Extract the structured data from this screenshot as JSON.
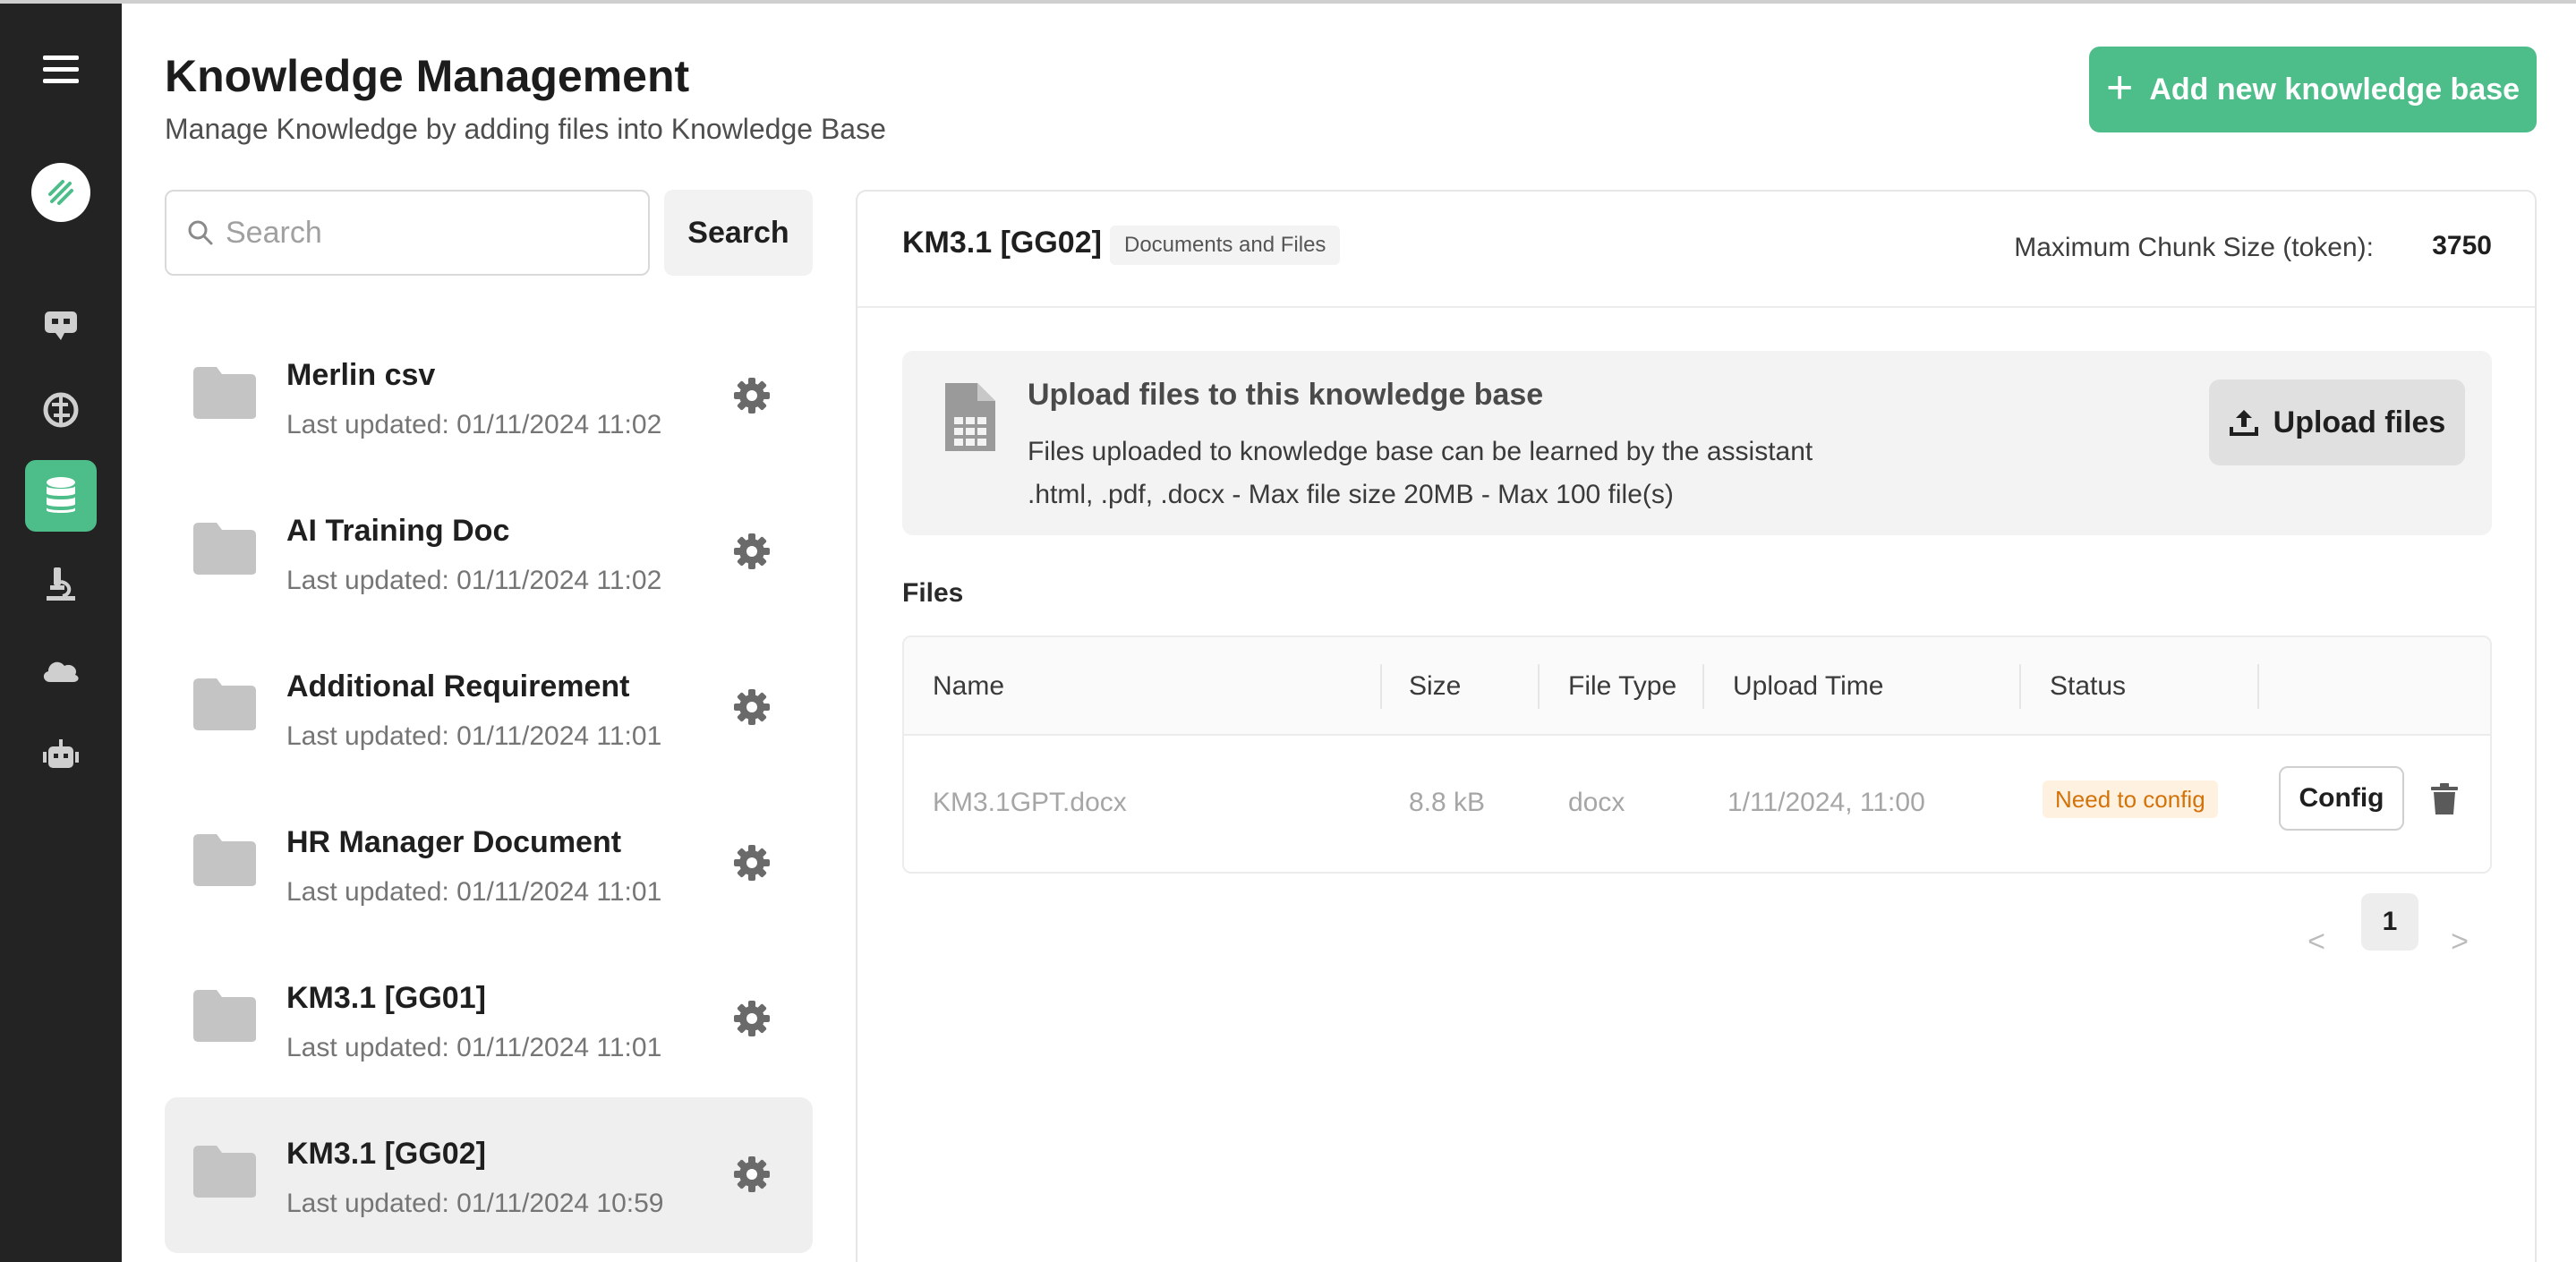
{
  "header": {
    "title": "Knowledge Management",
    "subtitle": "Manage Knowledge by adding files into Knowledge Base",
    "add_button_label": "Add new knowledge base"
  },
  "search": {
    "placeholder": "Search",
    "value": "",
    "button_label": "Search"
  },
  "sidebar": {
    "icons": [
      "menu-icon",
      "brand-logo-icon",
      "chat-bot-icon",
      "brain-icon",
      "database-icon",
      "microscope-icon",
      "cloud-icon",
      "robot-icon"
    ],
    "active": "database-icon",
    "accent_color": "#4dbd8a"
  },
  "knowledge_bases": [
    {
      "name": "Merlin csv",
      "updated": "Last updated: 01/11/2024 11:02"
    },
    {
      "name": "AI Training Doc",
      "updated": "Last updated: 01/11/2024 11:02"
    },
    {
      "name": "Additional Requirement",
      "updated": "Last updated: 01/11/2024 11:01"
    },
    {
      "name": "HR Manager Document",
      "updated": "Last updated: 01/11/2024 11:01"
    },
    {
      "name": "KM3.1 [GG01]",
      "updated": "Last updated: 01/11/2024 11:01"
    },
    {
      "name": "KM3.1 [GG02]",
      "updated": "Last updated: 01/11/2024 10:59"
    }
  ],
  "detail": {
    "kb_title": "KM3.1 [GG02]",
    "kb_tag": "Documents and Files",
    "chunk_label": "Maximum Chunk Size (token):",
    "chunk_value": "3750",
    "upload": {
      "title": "Upload files to this knowledge base",
      "description": "Files uploaded to knowledge base can be learned by the assistant",
      "types": ".html, .pdf, .docx - Max file size 20MB - Max 100 file(s)",
      "button_label": "Upload files"
    },
    "files_label": "Files",
    "table": {
      "columns": [
        "Name",
        "Size",
        "File Type",
        "Upload Time",
        "Status"
      ],
      "rows": [
        {
          "name": "KM3.1GPT.docx",
          "size": "8.8 kB",
          "type": "docx",
          "upload_time": "1/11/2024, 11:00",
          "status": "Need to config",
          "action_label": "Config"
        }
      ]
    },
    "pagination": {
      "current_page": "1",
      "prev": "<",
      "next": ">"
    }
  }
}
